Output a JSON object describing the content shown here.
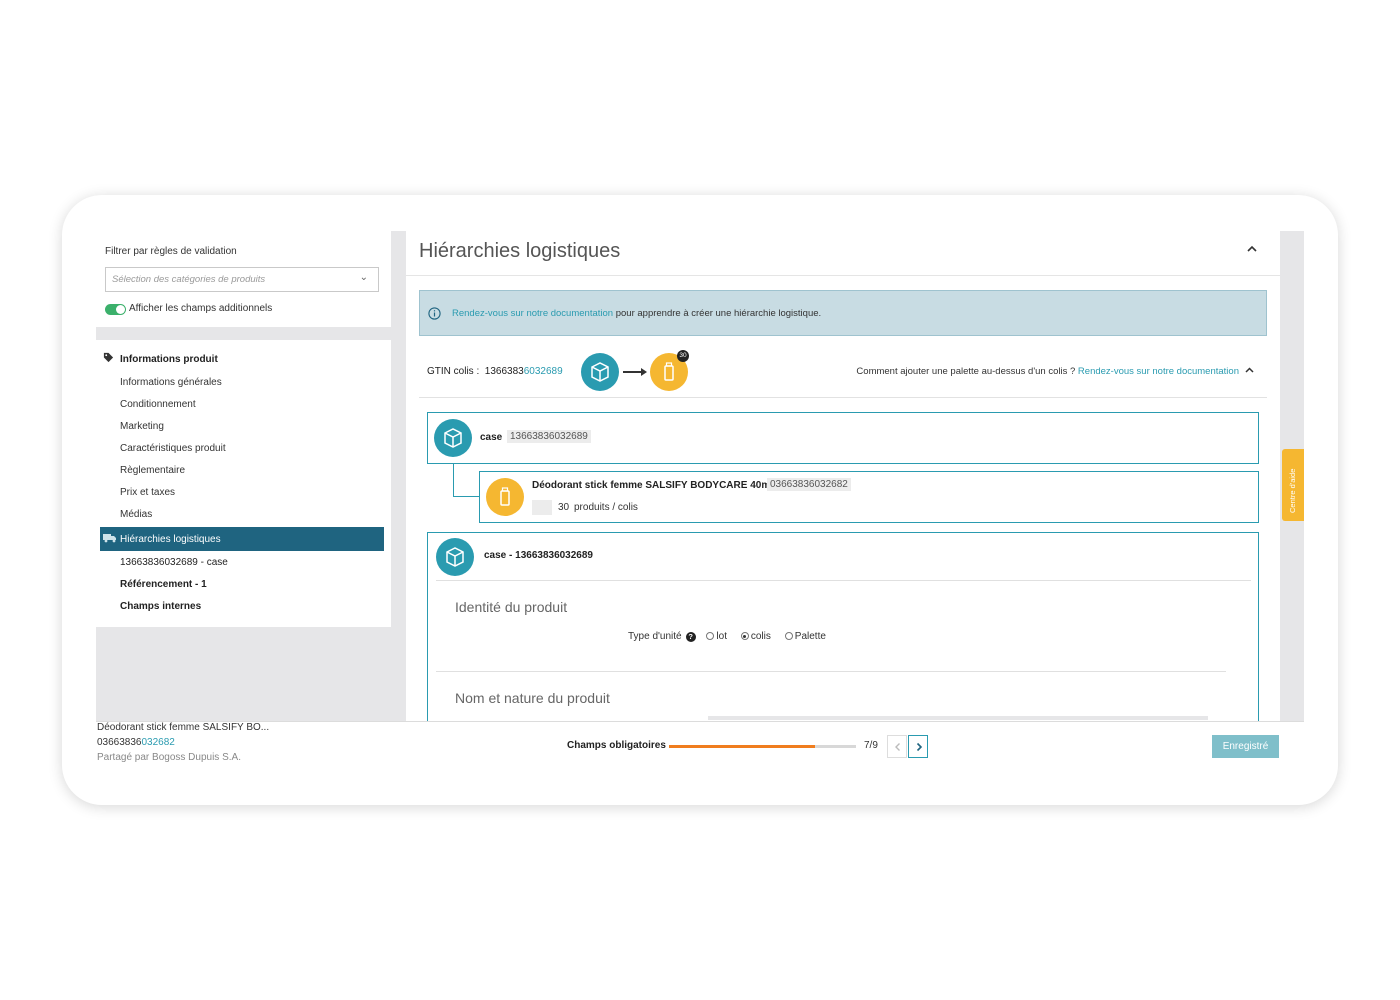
{
  "sidebar": {
    "filter_label": "Filtrer par règles de validation",
    "select_placeholder": "Sélection des catégories de produits",
    "toggle_label": "Afficher les champs additionnels",
    "toggle_on": true,
    "section_title": "Informations produit",
    "items": [
      {
        "label": "Informations générales"
      },
      {
        "label": "Conditionnement"
      },
      {
        "label": "Marketing"
      },
      {
        "label": "Caractéristiques produit"
      },
      {
        "label": "Règlementaire"
      },
      {
        "label": "Prix et taxes"
      },
      {
        "label": "Médias"
      }
    ],
    "active_item": "Hiérarchies logistiques",
    "sub_items": [
      {
        "label": "13663836032689 - case"
      },
      {
        "label": "Référencement - 1"
      },
      {
        "label": "Champs internes"
      }
    ]
  },
  "main": {
    "title": "Hiérarchies logistiques",
    "info": {
      "link": "Rendez-vous sur notre documentation",
      "text": " pour apprendre à créer une hiérarchie logistique."
    },
    "gtin": {
      "label": "GTIN colis :",
      "value_prefix": "1366383",
      "value_suffix": "6032689",
      "badge": "30",
      "howto_text": "Comment ajouter une palette au-dessus d'un colis ? ",
      "howto_link": "Rendez-vous sur notre documentation"
    },
    "case_row": {
      "label": "case",
      "gtin": "13663836032689"
    },
    "product_row": {
      "name": "Déodorant stick femme SALSIFY BODYCARE 40ml",
      "gtin": "03663836032682",
      "qty": "30",
      "unit": "produits / colis"
    },
    "detail": {
      "title": "case - 13663836032689",
      "section1": "Identité du produit",
      "unit_type_label": "Type d'unité",
      "unit_options": [
        {
          "label": "lot",
          "selected": false
        },
        {
          "label": "colis",
          "selected": true
        },
        {
          "label": "Palette",
          "selected": false
        }
      ],
      "section2": "Nom et nature du produit"
    },
    "help_tab": "Centre d'aide"
  },
  "footer": {
    "product_name": "Déodorant stick femme SALSIFY BO...",
    "gtin_prefix": "03663836",
    "gtin_suffix": "032682",
    "shared_by": "Partagé par Bogoss Dupuis S.A.",
    "required_label": "Champs obligatoires",
    "required_count": "7/9",
    "progress_fraction": 0.78,
    "save_label": "Enregistré"
  },
  "colors": {
    "accent": "#2a9bb0",
    "nav_active": "#1f6480",
    "product_yellow": "#f5b731",
    "progress": "#f07d1e",
    "toggle": "#3bb06b"
  }
}
